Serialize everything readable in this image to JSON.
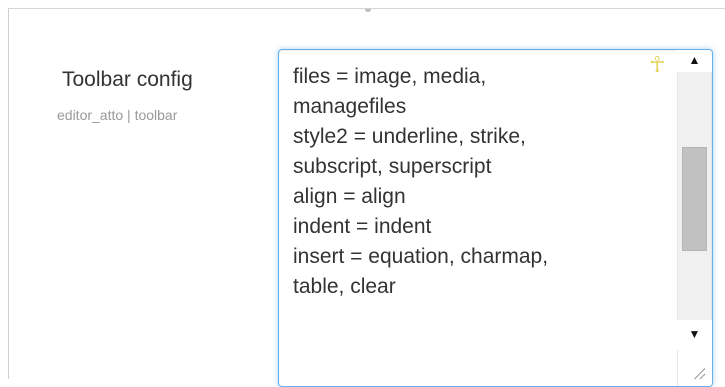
{
  "setting": {
    "label": "Toolbar config",
    "name": "editor_atto | toolbar"
  },
  "textarea": {
    "value": "files = image, media,\nmanagefiles\nstyle2 = underline, strike,\nsubscript, superscript\nalign = align\nindent = indent\ninsert = equation, charmap,\ntable, clear"
  },
  "icons": {
    "textarea_marker": "ankh-icon",
    "scroll_up": "scroll-up-arrow-icon",
    "scroll_down": "scroll-down-arrow-icon",
    "resize": "resize-grip-icon"
  },
  "colors": {
    "focus_border": "#66afe9",
    "label_text": "#333333",
    "muted_text": "#999999",
    "marker_icon": "#e4d25a"
  }
}
